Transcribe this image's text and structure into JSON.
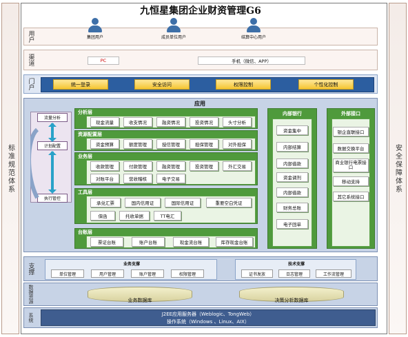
{
  "title": "九恒星集团企业财资管理G6",
  "side_left": "标准规范体系",
  "side_right": "安全保障体系",
  "user_layer": {
    "label": "用户",
    "users": [
      "集团用户",
      "成员单位用户",
      "结算中心用户"
    ]
  },
  "channel_layer": {
    "label": "渠道",
    "items": [
      "PC",
      "手机（微信、APP）"
    ]
  },
  "portal_layer": {
    "label": "门户",
    "items": [
      "统一登录",
      "安全访问",
      "权限控制",
      "个性化控制"
    ]
  },
  "application": {
    "title": "应用",
    "flow": [
      "流量分析",
      "计划配置",
      "执行管控"
    ],
    "analysis": {
      "title": "分析层",
      "items": [
        "现金流量",
        "收支情况",
        "融资情况",
        "投资情况",
        "头寸分析"
      ]
    },
    "allocation": {
      "title": "资源配置层",
      "items": [
        "资金预算",
        "额度管理",
        "授信管理",
        "担保管理",
        "对外担保"
      ]
    },
    "business": {
      "title": "业务层",
      "items": [
        "收款管理",
        "付款管理",
        "融资管理",
        "投资管理",
        "外汇交易",
        "对账平台",
        "营收稽核",
        "电子交易"
      ]
    },
    "tools": {
      "title": "工具层",
      "items": [
        "承兑汇票",
        "国内信用证",
        "国际信用证",
        "重要空白凭证",
        "保函",
        "托收单据",
        "TT电汇"
      ]
    },
    "ledger": {
      "title": "台账层",
      "items": [
        "票证台账",
        "账户台账",
        "现金流台账",
        "库存现金台账"
      ]
    },
    "internal_bank": {
      "title": "内部银行",
      "items": [
        "资金集中",
        "内部结算",
        "内部借款",
        "资金调剂",
        "内部借款",
        "财务总账",
        "电子回单"
      ]
    },
    "external": {
      "title": "外部接口",
      "items": [
        "银企直联接口",
        "数据交换平台",
        "商业银行电票接口",
        "移动支持",
        "其它系统接口"
      ]
    }
  },
  "support": {
    "label": "支撑",
    "business_title": "业务支撑",
    "business_items": [
      "单位管理",
      "用户管理",
      "账户管理",
      "权限管理"
    ],
    "tech_title": "技术支撑",
    "tech_items": [
      "证书发放",
      "日志管理",
      "工作流管理"
    ]
  },
  "data_resources": {
    "label": "数据资源",
    "items": [
      "业务数据库",
      "决策分析数据库"
    ]
  },
  "system": {
    "label": "系统",
    "line1": "J2EE应用服务器（Weblogic、TongWeb）",
    "line2": "操作系统（Windows 、Linux、AIX）"
  },
  "colors": {
    "panel_green": "#4f9a3c",
    "portal_blue": "#2c5ea0",
    "gold": "#f5c531",
    "purple": "#8a5a95",
    "base_blue": "#3f5d8f"
  }
}
